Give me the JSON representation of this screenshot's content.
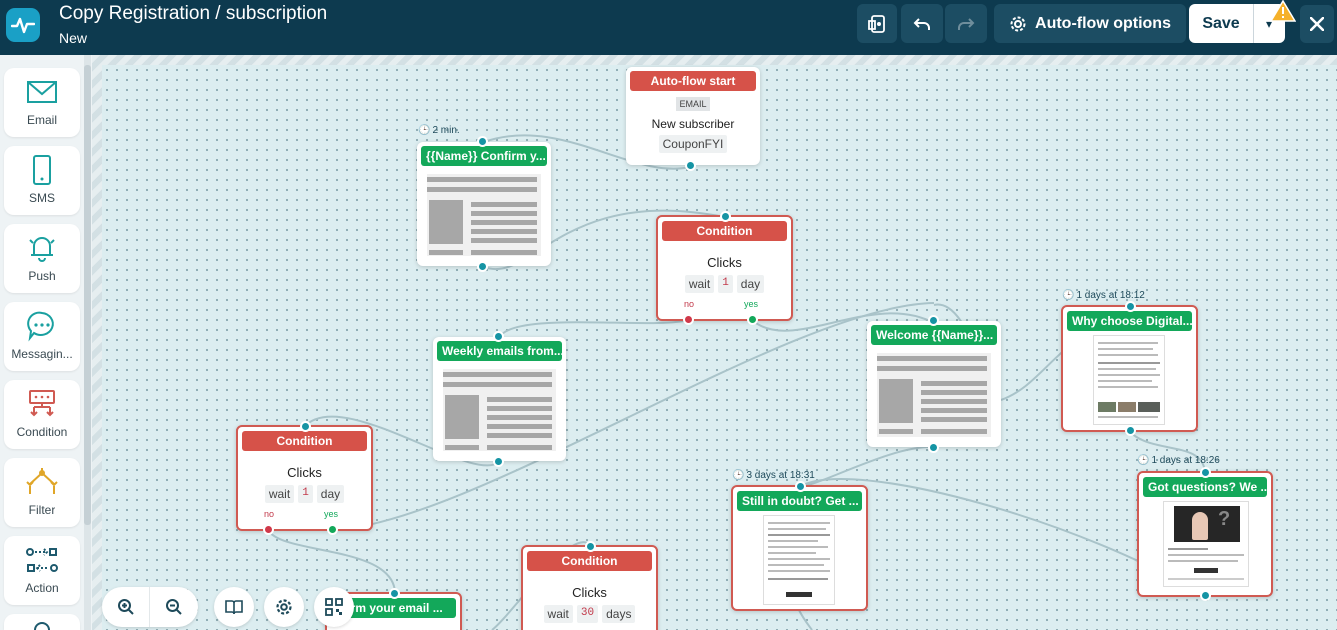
{
  "header": {
    "title": "Copy Registration / subscription",
    "subtitle": "New",
    "autoflow_label": "Auto-flow options",
    "save_label": "Save"
  },
  "sidebar": {
    "items": [
      {
        "label": "Email",
        "icon": "envelope-icon"
      },
      {
        "label": "SMS",
        "icon": "phone-icon"
      },
      {
        "label": "Push",
        "icon": "bell-icon"
      },
      {
        "label": "Messagin...",
        "icon": "chat-bubble-icon"
      },
      {
        "label": "Condition",
        "icon": "condition-icon"
      },
      {
        "label": "Filter",
        "icon": "filter-icon"
      },
      {
        "label": "Action",
        "icon": "action-icon"
      }
    ]
  },
  "nodes": {
    "start": {
      "title": "Auto-flow start",
      "badge": "EMAIL",
      "trigger": "New subscriber",
      "list": "CouponFYI"
    },
    "email1": {
      "title": "{{Name}} Confirm y...",
      "timer": "2 min."
    },
    "cond1": {
      "title": "Condition",
      "label": "Clicks",
      "wait": "wait",
      "num": "1",
      "unit": "day",
      "no": "no",
      "yes": "yes"
    },
    "email2": {
      "title": "Weekly emails from..."
    },
    "email3": {
      "title": "Welcome {{Name}}..."
    },
    "email4": {
      "title": "Why choose Digital...",
      "timer": "1 days at 18:12"
    },
    "cond2": {
      "title": "Condition",
      "label": "Clicks",
      "wait": "wait",
      "num": "1",
      "unit": "day",
      "no": "no",
      "yes": "yes"
    },
    "email5": {
      "title": "Still in doubt? Get ...",
      "timer": "3 days at 18:31"
    },
    "email6": {
      "title": "Got questions? We ...",
      "timer": "1 days at 18:26"
    },
    "cond3": {
      "title": "Condition",
      "label": "Clicks",
      "wait": "wait",
      "num": "30",
      "unit": "days"
    },
    "email7": {
      "title": "nfirm your email ..."
    }
  },
  "colors": {
    "header": "#0d3a4f",
    "accent": "#1aa0c6",
    "green": "#13a85a",
    "red": "#d65249"
  }
}
